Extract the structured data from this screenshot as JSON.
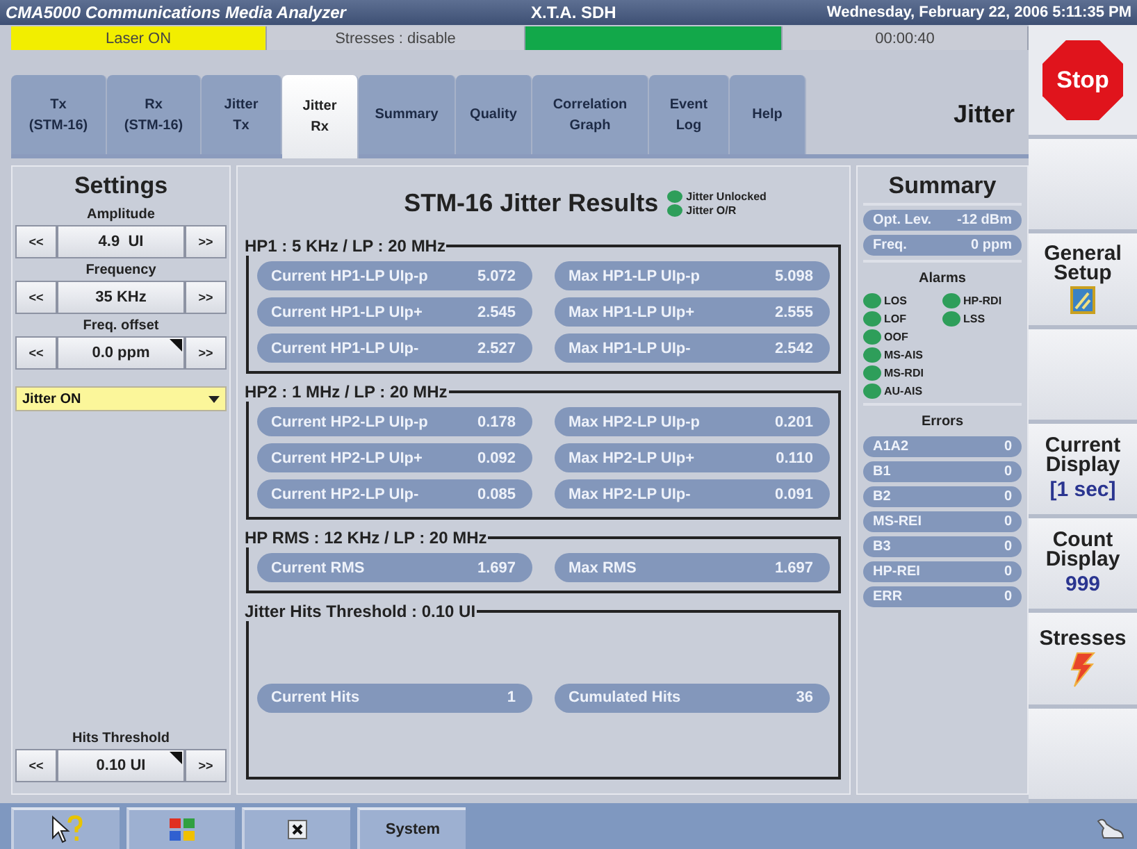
{
  "title_bar": {
    "app": "CMA5000 Communications Media Analyzer",
    "mode": "X.T.A. SDH",
    "datetime": "Wednesday, February 22, 2006 5:11:35 PM"
  },
  "status": [
    {
      "text": "Laser ON",
      "color": "#f2ee00"
    },
    {
      "text": "Stresses : disable",
      "color": "#c9ccd6"
    },
    {
      "color": "#12a84a"
    },
    {
      "text": "00:00:40",
      "color": "#c9ccd6"
    }
  ],
  "tabs": [
    {
      "label": "Tx\n(STM-16)",
      "selected": false
    },
    {
      "label": "Rx\n(STM-16)",
      "selected": false
    },
    {
      "label": "Jitter\nTx",
      "selected": false
    },
    {
      "label": "Jitter\nRx",
      "selected": true
    },
    {
      "label": "Summary",
      "selected": false
    },
    {
      "label": "Quality",
      "selected": false
    },
    {
      "label": "Correlation\nGraph",
      "selected": false
    },
    {
      "label": "Event\nLog",
      "selected": false
    },
    {
      "label": "Help",
      "selected": false
    }
  ],
  "page_title": "Jitter",
  "stop_button": "Stop",
  "side_buttons": [
    {
      "kind": "blank"
    },
    {
      "kind": "setup",
      "label": "General\nSetup"
    },
    {
      "kind": "blank"
    },
    {
      "kind": "value",
      "label": "Current\nDisplay",
      "value": "[1 sec]"
    },
    {
      "kind": "value",
      "label": "Count\nDisplay",
      "value": "999"
    },
    {
      "kind": "stresses",
      "label": "Stresses"
    },
    {
      "kind": "blank"
    }
  ],
  "settings": {
    "title": "Settings",
    "controls": [
      {
        "label": "Amplitude",
        "value": "4.9  UI",
        "dec": "<<",
        "inc": ">>",
        "flagged": false
      },
      {
        "label": "Frequency",
        "value": "35 KHz",
        "dec": "<<",
        "inc": ">>",
        "flagged": false
      },
      {
        "label": "Freq. offset",
        "value": "0.0 ppm",
        "dec": "<<",
        "inc": ">>",
        "flagged": true
      }
    ],
    "dropdown": "Jitter ON",
    "threshold": {
      "label": "Hits Threshold",
      "value": "0.10 UI",
      "dec": "<<",
      "inc": ">>",
      "flagged": true
    }
  },
  "results": {
    "title": "STM-16  Jitter Results",
    "indicators": [
      {
        "label": "Jitter Unlocked",
        "color": "#2e9e5a"
      },
      {
        "label": "Jitter O/R",
        "color": "#2e9e5a"
      }
    ],
    "groups": [
      {
        "title": "HP1 : 5 KHz / LP : 20 MHz",
        "rows": [
          [
            {
              "label": "Current HP1-LP UIp-p",
              "value": "5.072"
            },
            {
              "label": "Max HP1-LP UIp-p",
              "value": "5.098"
            }
          ],
          [
            {
              "label": "Current HP1-LP UIp+",
              "value": "2.545"
            },
            {
              "label": "Max HP1-LP UIp+",
              "value": "2.555"
            }
          ],
          [
            {
              "label": "Current HP1-LP UIp-",
              "value": "2.527"
            },
            {
              "label": "Max HP1-LP UIp-",
              "value": "2.542"
            }
          ]
        ]
      },
      {
        "title": "HP2 : 1 MHz / LP : 20 MHz",
        "rows": [
          [
            {
              "label": "Current HP2-LP UIp-p",
              "value": "0.178"
            },
            {
              "label": "Max HP2-LP UIp-p",
              "value": "0.201"
            }
          ],
          [
            {
              "label": "Current HP2-LP UIp+",
              "value": "0.092"
            },
            {
              "label": "Max HP2-LP UIp+",
              "value": "0.110"
            }
          ],
          [
            {
              "label": "Current HP2-LP UIp-",
              "value": "0.085"
            },
            {
              "label": "Max HP2-LP UIp-",
              "value": "0.091"
            }
          ]
        ]
      },
      {
        "title": "HP RMS : 12 KHz / LP : 20 MHz",
        "rows": [
          [
            {
              "label": "Current RMS",
              "value": "1.697"
            },
            {
              "label": "Max RMS",
              "value": "1.697"
            }
          ]
        ]
      },
      {
        "title": "Jitter Hits Threshold : 0.10 UI",
        "rows": [
          [
            {
              "label": "Current Hits",
              "value": "1"
            },
            {
              "label": "Cumulated Hits",
              "value": "36"
            }
          ]
        ]
      }
    ]
  },
  "summary": {
    "title": "Summary",
    "readings": [
      {
        "label": "Opt. Lev.",
        "value": "-12 dBm"
      },
      {
        "label": "Freq.",
        "value": "0 ppm"
      }
    ],
    "alarms_title": "Alarms",
    "alarms": [
      {
        "label": "LOS",
        "color": "#2e9e5a"
      },
      {
        "label": "HP-RDI",
        "color": "#2e9e5a"
      },
      {
        "label": "LOF",
        "color": "#2e9e5a"
      },
      {
        "label": "LSS",
        "color": "#2e9e5a"
      },
      {
        "label": "OOF",
        "color": "#2e9e5a"
      },
      {
        "label": "MS-AIS",
        "color": "#2e9e5a"
      },
      {
        "label": "MS-RDI",
        "color": "#2e9e5a"
      },
      {
        "label": "AU-AIS",
        "color": "#2e9e5a"
      }
    ],
    "errors_title": "Errors",
    "errors": [
      {
        "label": "A1A2",
        "value": "0"
      },
      {
        "label": "B1",
        "value": "0"
      },
      {
        "label": "B2",
        "value": "0"
      },
      {
        "label": "MS-REI",
        "value": "0"
      },
      {
        "label": "B3",
        "value": "0"
      },
      {
        "label": "HP-REI",
        "value": "0"
      },
      {
        "label": "ERR",
        "value": "0"
      }
    ]
  },
  "taskbar": [
    {
      "kind": "help"
    },
    {
      "kind": "squares"
    },
    {
      "kind": "close"
    },
    {
      "kind": "text",
      "label": "System"
    }
  ]
}
